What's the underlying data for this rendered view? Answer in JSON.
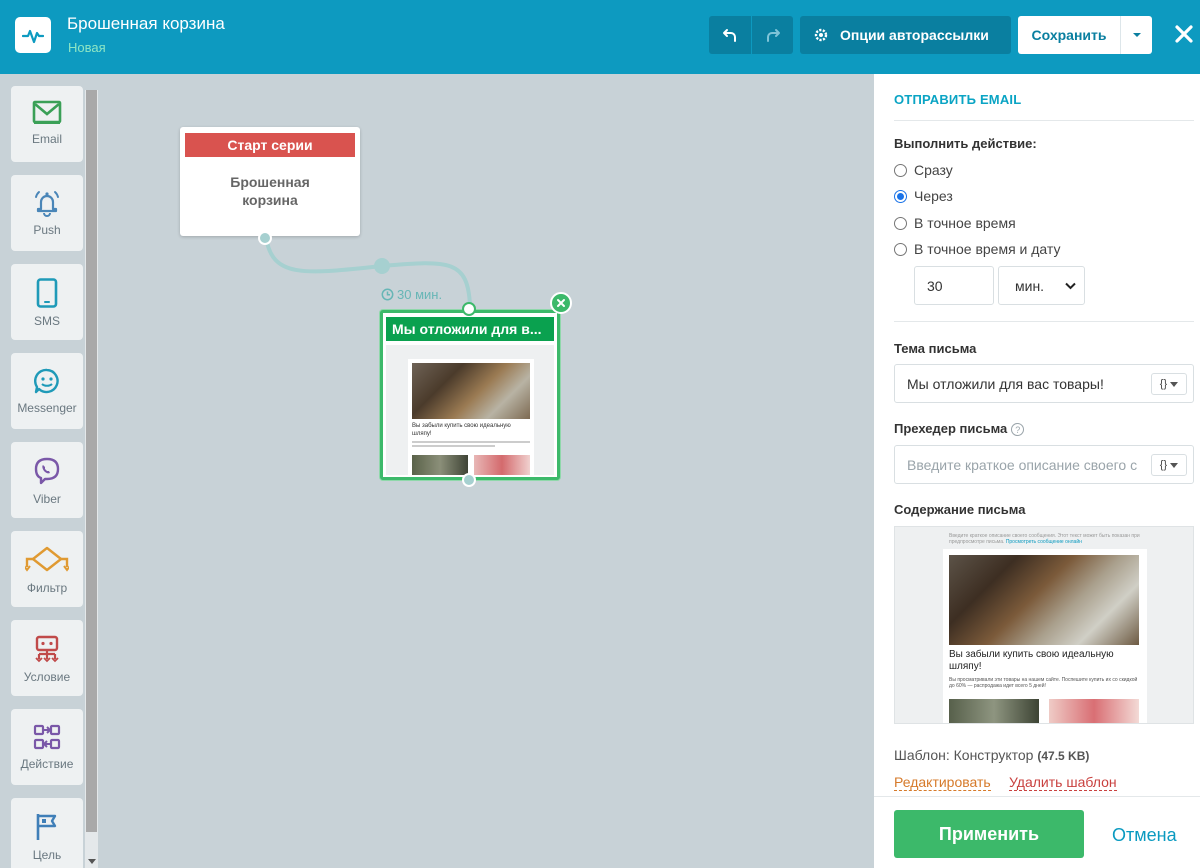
{
  "header": {
    "title": "Брошенная корзина",
    "status": "Новая",
    "options_label": "Опции авторассылки",
    "save_label": "Сохранить"
  },
  "palette": {
    "items": [
      {
        "label": "Email",
        "icon": "email-icon"
      },
      {
        "label": "Push",
        "icon": "bell-icon"
      },
      {
        "label": "SMS",
        "icon": "phone-icon"
      },
      {
        "label": "Messenger",
        "icon": "chat-icon"
      },
      {
        "label": "Viber",
        "icon": "viber-icon"
      },
      {
        "label": "Фильтр",
        "icon": "filter-icon"
      },
      {
        "label": "Условие",
        "icon": "condition-icon"
      },
      {
        "label": "Действие",
        "icon": "action-icon"
      },
      {
        "label": "Цель",
        "icon": "flag-icon"
      }
    ]
  },
  "canvas": {
    "start_node": {
      "header": "Старт серии",
      "body_line1": "Брошенная",
      "body_line2": "корзина"
    },
    "delay": "30 мин.",
    "email_node": {
      "header": "Мы отложили для в...",
      "preview_heading_line1": "Вы забыли купить свою идеальную",
      "preview_heading_line2": "шляпу!"
    }
  },
  "panel": {
    "title": "ОТПРАВИТЬ EMAIL",
    "action_label": "Выполнить действие:",
    "options": [
      "Сразу",
      "Через",
      "В точное время",
      "В точное время и дату"
    ],
    "selected_option": "Через",
    "delay_value": "30",
    "delay_unit": "мин.",
    "subject_label": "Тема письма",
    "subject_value": "Мы отложили для вас товары!",
    "preheader_label": "Прехедер письма",
    "preheader_placeholder": "Введите краткое описание своего с",
    "content_label": "Содержание письма",
    "preview": {
      "top_text": "Введите краткое описание своего сообщения. Этот текст может быть показан при предпросмотре письма.",
      "top_link": "Просмотреть сообщение онлайн",
      "heading": "Вы забыли купить свою идеальную шляпу!",
      "paragraph": "Вы просматривали эти товары на нашем сайте. Поспешите купить их со скидкой до 60% — распродажа идет всего 5 дней!"
    },
    "template_prefix": "Шаблон: Конструктор",
    "template_size": "(47.5 KB)",
    "edit_link": "Редактировать",
    "delete_link": "Удалить шаблон",
    "var_button": "{}",
    "apply_label": "Применить",
    "cancel_label": "Отмена"
  },
  "colors": {
    "header_bg": "#0d9ac0",
    "accent_green": "#3cb96a",
    "start_red": "#d9534f",
    "link_teal": "#0a9ac0"
  }
}
